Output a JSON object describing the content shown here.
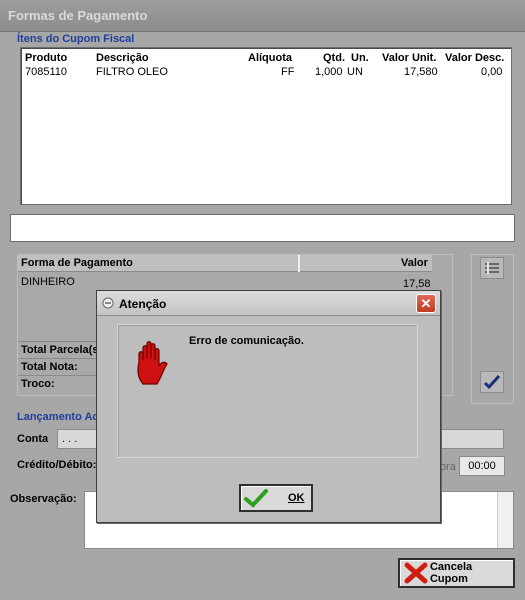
{
  "window": {
    "title": "Formas de Pagamento"
  },
  "items_section": {
    "title": "Ítens do Cupom Fiscal",
    "columns": [
      "Produto",
      "Descrição",
      "Alíquota",
      "Qtd.",
      "Un.",
      "Valor Unit.",
      "Valor Desc."
    ],
    "rows": [
      {
        "produto": "7085110",
        "descricao": "FILTRO OLEO",
        "aliquota": "FF",
        "qtd": "1,000",
        "un": "UN",
        "valor_unit": "17,580",
        "valor_desc": "0,00"
      }
    ]
  },
  "payment": {
    "columns": {
      "forma": "Forma de Pagamento",
      "valor": "Valor"
    },
    "rows": [
      {
        "forma": "DINHEIRO",
        "valor": "17,58"
      }
    ],
    "totals": {
      "parcelas_label": "Total Parcela(s)",
      "nota_label": "Total Nota:",
      "troco_label": "Troco:"
    }
  },
  "lancamento": {
    "title": "Lançamento Ac",
    "conta_label": "Conta",
    "conta_value": ". . .",
    "credito_label": "Crédito/Débito:",
    "hora_label": "ora",
    "hora_value": "00:00"
  },
  "observacao": {
    "label": "Observação:"
  },
  "buttons": {
    "cancel": "Cancela Cupom"
  },
  "dialog": {
    "title": "Atenção",
    "message": "Erro de comunicação.",
    "ok_label": "OK"
  },
  "icons": {
    "add": "list-add-icon",
    "confirm": "checkmark-icon",
    "stop": "stop-hand-icon",
    "cancel": "red-x-icon",
    "ok": "green-check-icon"
  }
}
